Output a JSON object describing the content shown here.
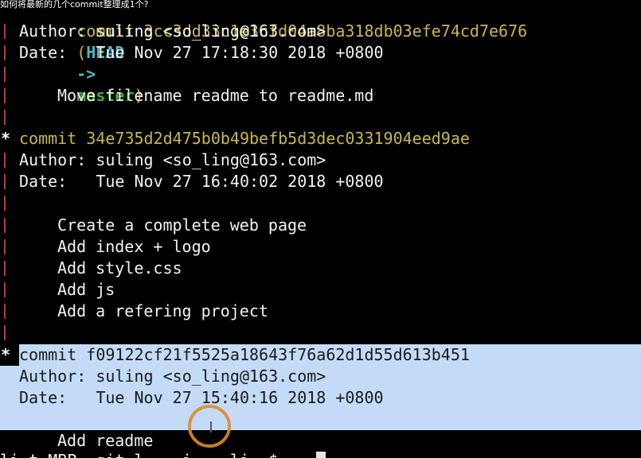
{
  "caption": "如何将最新的几个commit整理成1个?",
  "commits": [
    {
      "hash_line": "commit 3cc3dd33c1e3cfd04a8ba318db03efe74cd7e676",
      "refs": {
        "open": "(",
        "head": "HEAD",
        "arrow": "->",
        "branch": "master",
        "close": ")"
      },
      "author": "Author: suling <so_ling@163.com>",
      "date": "Date:   Tue Nov 27 17:18:30 2018 +0800",
      "message": [
        "Move filename readme to readme.md"
      ]
    },
    {
      "hash_line": "commit 34e735d2d475b0b49befb5d3dec0331904eed9ae",
      "author": "Author: suling <so_ling@163.com>",
      "date": "Date:   Tue Nov 27 16:40:02 2018 +0800",
      "message": [
        "Create a complete web page",
        "Add index + logo",
        "Add style.css",
        "Add js",
        "Add a refering project"
      ]
    },
    {
      "hash_line": "commit f09122cf21f5525a18643f76a62d1d55d613b451",
      "author": "Author: suling <so_ling@163.com>",
      "date": "Date:   Tue Nov 27 15:40:16 2018 +0800",
      "message": [
        "Add readme"
      ]
    }
  ],
  "prompt": "li t MBP  git l    i    li  $",
  "graph_star": "*",
  "colors": {
    "background": "#000000",
    "commit_hash": "#c8b84a",
    "graph_bar": "#c0392b",
    "head_ref": "#4fb6c4",
    "branch_ref": "#3fae3f",
    "selection": "#c3dbf6",
    "cursor_ring": "#e0892a"
  }
}
